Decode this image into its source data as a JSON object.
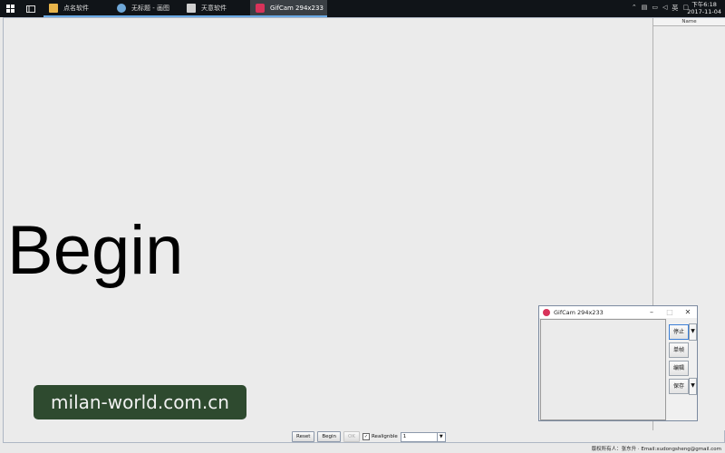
{
  "taskbar": {
    "apps": [
      {
        "label": "点名软件",
        "icon": "folder-icon",
        "color": "#e8b44a"
      },
      {
        "label": "无标题 - 画图",
        "icon": "paint-icon",
        "color": "#6fa8d8"
      },
      {
        "label": "天意软件",
        "icon": "app-window-icon",
        "color": "#cfcfcf"
      },
      {
        "label": "GifCam 294x233",
        "icon": "gifcam-icon",
        "color": "#d8335a"
      }
    ],
    "clock": {
      "time": "下午6:18",
      "date": "2017-11-04"
    }
  },
  "main": {
    "big_text": "Begin",
    "name_column_header": "Name",
    "watermark": "milan-world.com.cn",
    "controls": {
      "reset": "Reset",
      "begin": "Begin",
      "ok": "OK",
      "checkbox_label": "Realignble",
      "checkbox_checked": "✓",
      "combo_value": "1"
    },
    "footer": "版权所有人：张东升 · Email:xudongsheng@gmail.com"
  },
  "gifcam": {
    "title": "GifCam 294x233",
    "buttons": {
      "stop": "停止",
      "single": "单帧",
      "edit": "编辑",
      "save": "保存"
    }
  }
}
